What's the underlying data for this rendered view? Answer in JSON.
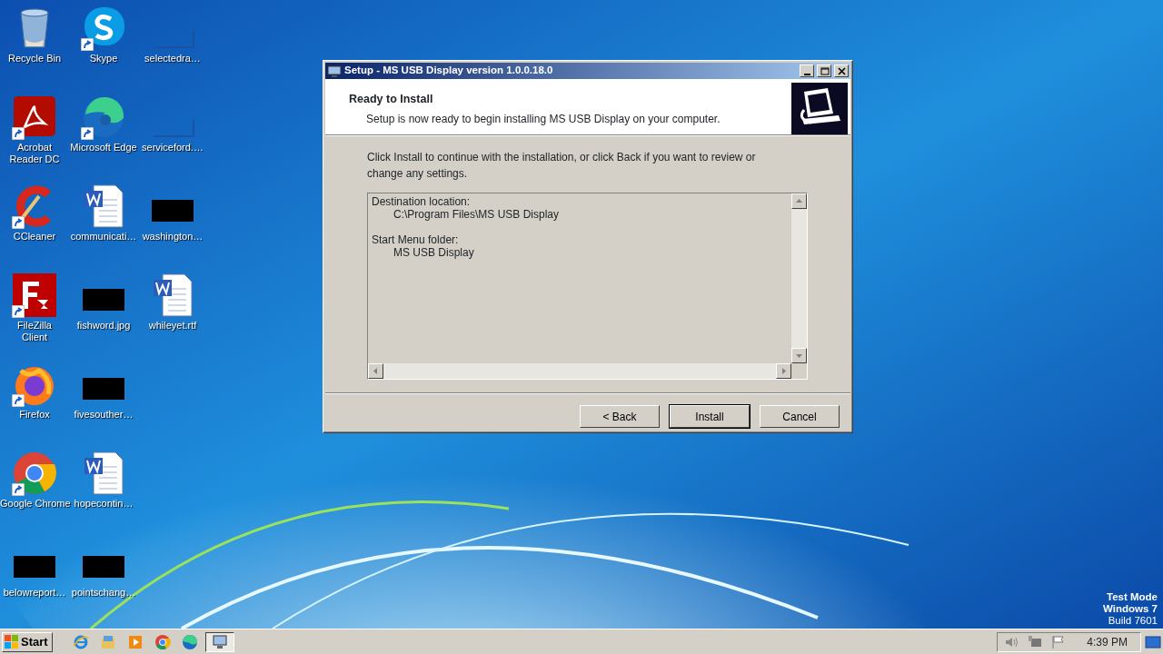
{
  "desktop": {
    "icons": [
      {
        "label": "Recycle Bin",
        "kind": "recycle",
        "shortcut": false
      },
      {
        "label": "Acrobat Reader DC",
        "kind": "acrobat",
        "shortcut": true
      },
      {
        "label": "CCleaner",
        "kind": "ccleaner",
        "shortcut": true
      },
      {
        "label": "FileZilla Client",
        "kind": "filezilla",
        "shortcut": true
      },
      {
        "label": "Firefox",
        "kind": "firefox",
        "shortcut": true
      },
      {
        "label": "Google Chrome",
        "kind": "chrome",
        "shortcut": true
      },
      {
        "label": "belowreport…",
        "kind": "black",
        "shortcut": false
      },
      {
        "label": "Skype",
        "kind": "skype",
        "shortcut": true
      },
      {
        "label": "Microsoft Edge",
        "kind": "edge",
        "shortcut": true
      },
      {
        "label": "communicati…",
        "kind": "word",
        "shortcut": false
      },
      {
        "label": "fishword.jpg",
        "kind": "black",
        "shortcut": false
      },
      {
        "label": "fivesouther…",
        "kind": "black",
        "shortcut": false
      },
      {
        "label": "hopecontin…",
        "kind": "word",
        "shortcut": false
      },
      {
        "label": "pointschang…",
        "kind": "black",
        "shortcut": false
      },
      {
        "label": "selectedra…",
        "kind": "blank",
        "shortcut": false
      },
      {
        "label": "serviceford.…",
        "kind": "blank",
        "shortcut": false
      },
      {
        "label": "washington…",
        "kind": "black",
        "shortcut": false
      },
      {
        "label": "whileyet.rtf",
        "kind": "word",
        "shortcut": false
      }
    ]
  },
  "dialog": {
    "title": "Setup - MS USB Display version 1.0.0.18.0",
    "heading": "Ready to Install",
    "subheading": "Setup is now ready to begin installing MS USB Display on your computer.",
    "instruction": "Click Install to continue with the installation, or click Back if you want to review or change any settings.",
    "memo": [
      {
        "heading": "Destination location:",
        "value": "C:\\Program Files\\MS USB Display"
      },
      {
        "heading": "Start Menu folder:",
        "value": "MS USB Display"
      }
    ],
    "buttons": [
      {
        "label": "< Back",
        "default": false
      },
      {
        "label": "Install",
        "default": true
      },
      {
        "label": "Cancel",
        "default": false
      }
    ]
  },
  "taskbar": {
    "start": "Start",
    "quick_launch": [
      {
        "kind": "ie"
      },
      {
        "kind": "explorer"
      },
      {
        "kind": "media"
      },
      {
        "kind": "chrome"
      },
      {
        "kind": "edge"
      }
    ],
    "tasks": [
      {
        "kind": "setup",
        "active": true
      }
    ],
    "clock": "4:39 PM"
  },
  "watermark": [
    "Test Mode",
    "Windows 7",
    "Build 7601"
  ]
}
